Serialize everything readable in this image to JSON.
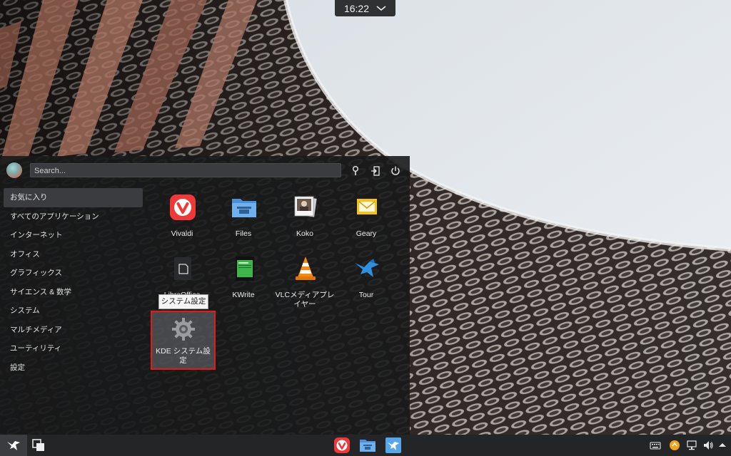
{
  "clock": {
    "time": "16:22"
  },
  "menu": {
    "search_placeholder": "Search...",
    "categories": [
      {
        "label": "お気に入り",
        "active": true
      },
      {
        "label": "すべてのアプリケーション"
      },
      {
        "label": "インターネット"
      },
      {
        "label": "オフィス"
      },
      {
        "label": "グラフィックス"
      },
      {
        "label": "サイエンス & 数学"
      },
      {
        "label": "システム"
      },
      {
        "label": "マルチメディア"
      },
      {
        "label": "ユーティリティ"
      },
      {
        "label": "設定"
      }
    ],
    "apps": [
      {
        "label": "Vivaldi",
        "icon": "vivaldi-icon"
      },
      {
        "label": "Files",
        "icon": "folder-icon"
      },
      {
        "label": "Koko",
        "icon": "photos-icon"
      },
      {
        "label": "Geary",
        "icon": "mail-icon"
      },
      {
        "label": "LibreOffice",
        "icon": "document-icon"
      },
      {
        "label": "KWrite",
        "icon": "text-editor-icon"
      },
      {
        "label": "VLCメディアプレイヤー",
        "icon": "vlc-cone-icon"
      },
      {
        "label": "Tour",
        "icon": "bird-icon"
      },
      {
        "label": "KDE システム設定",
        "icon": "gear-icon",
        "selected": true
      }
    ],
    "tooltip": "システム設定",
    "header_buttons": [
      "lock-icon",
      "logout-icon",
      "power-icon"
    ]
  },
  "taskbar": {
    "left": [
      "launcher-bird-icon",
      "show-desktop-icon"
    ],
    "center": [
      "vivaldi-icon",
      "folder-icon",
      "tour-icon"
    ],
    "tray": [
      "keyboard-icon",
      "updates-icon",
      "network-icon",
      "volume-icon",
      "tray-expand-icon"
    ]
  },
  "colors": {
    "menu_bg": "#18191b",
    "highlight_border": "#e21b1b",
    "vivaldi_red": "#ef3939",
    "folder_blue": "#5fa3e6"
  }
}
